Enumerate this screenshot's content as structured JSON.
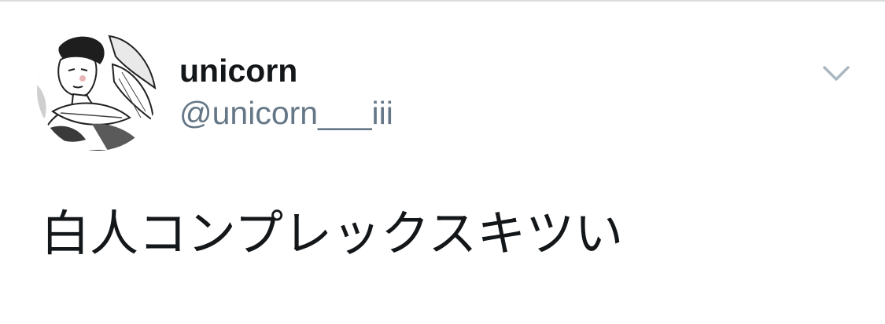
{
  "tweet": {
    "display_name": "unicorn",
    "handle": "@unicorn___iii",
    "text": "白人コンプレックスキツい",
    "avatar_icon": "profile-avatar-illustration",
    "menu_icon": "chevron-down-icon"
  },
  "colors": {
    "text_primary": "#14171a",
    "text_secondary": "#657786",
    "caret": "#aab8c2",
    "divider": "#d9dcdf"
  }
}
